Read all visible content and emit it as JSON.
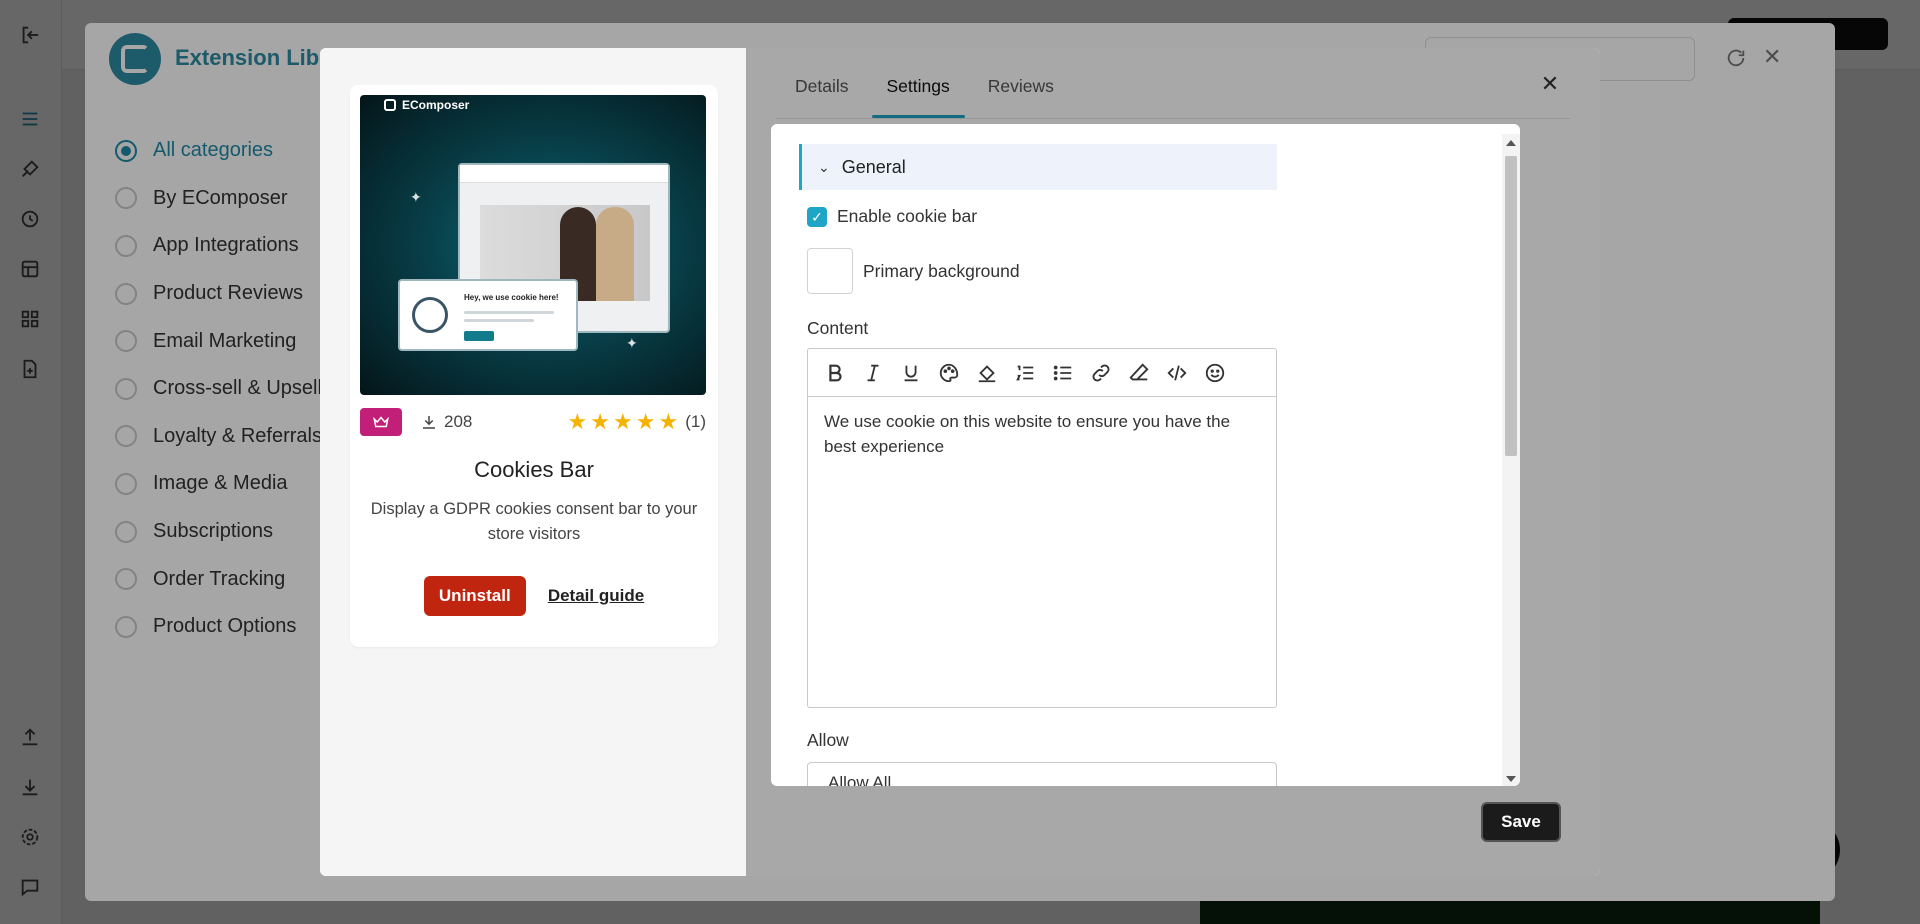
{
  "library": {
    "title": "Extension Library",
    "categories": [
      {
        "label": "All categories",
        "active": true
      },
      {
        "label": "By EComposer",
        "active": false
      },
      {
        "label": "App Integrations",
        "active": false
      },
      {
        "label": "Product Reviews",
        "active": false
      },
      {
        "label": "Email Marketing",
        "active": false
      },
      {
        "label": "Cross-sell & Upsell",
        "active": false
      },
      {
        "label": "Loyalty & Referrals",
        "active": false
      },
      {
        "label": "Image & Media",
        "active": false
      },
      {
        "label": "Subscriptions",
        "active": false
      },
      {
        "label": "Order Tracking",
        "active": false
      },
      {
        "label": "Product Options",
        "active": false
      }
    ]
  },
  "extension": {
    "brand": "EComposer",
    "thumb_popup_text": "Hey, we use cookie here!",
    "thumb_button_text": "Allow All",
    "downloads": "208",
    "rating_stars": 5,
    "rating_count": "(1)",
    "name": "Cookies Bar",
    "description": "Display a GDPR cookies consent bar to your store visitors",
    "uninstall_label": "Uninstall",
    "guide_label": "Detail guide"
  },
  "tabs": [
    {
      "label": "Details",
      "active": false
    },
    {
      "label": "Settings",
      "active": true
    },
    {
      "label": "Reviews",
      "active": false
    }
  ],
  "settings": {
    "section_title": "General",
    "enable_cookie_bar_label": "Enable cookie bar",
    "enable_cookie_bar_checked": true,
    "primary_background_label": "Primary background",
    "content_label": "Content",
    "content_text": "We use cookie on this website to ensure you have the best experience",
    "allow_label": "Allow",
    "allow_value": "Allow All"
  },
  "save_label": "Save",
  "colors": {
    "accent": "#1fa5c6",
    "danger": "#c0250f",
    "premium": "#c21f79",
    "star": "#f5b301"
  },
  "icons": {
    "toolbar": [
      "bold-icon",
      "italic-icon",
      "underline-icon",
      "palette-icon",
      "fill-icon",
      "ordered-list-icon",
      "bullet-list-icon",
      "link-icon",
      "eraser-icon",
      "code-icon",
      "emoji-icon"
    ]
  }
}
